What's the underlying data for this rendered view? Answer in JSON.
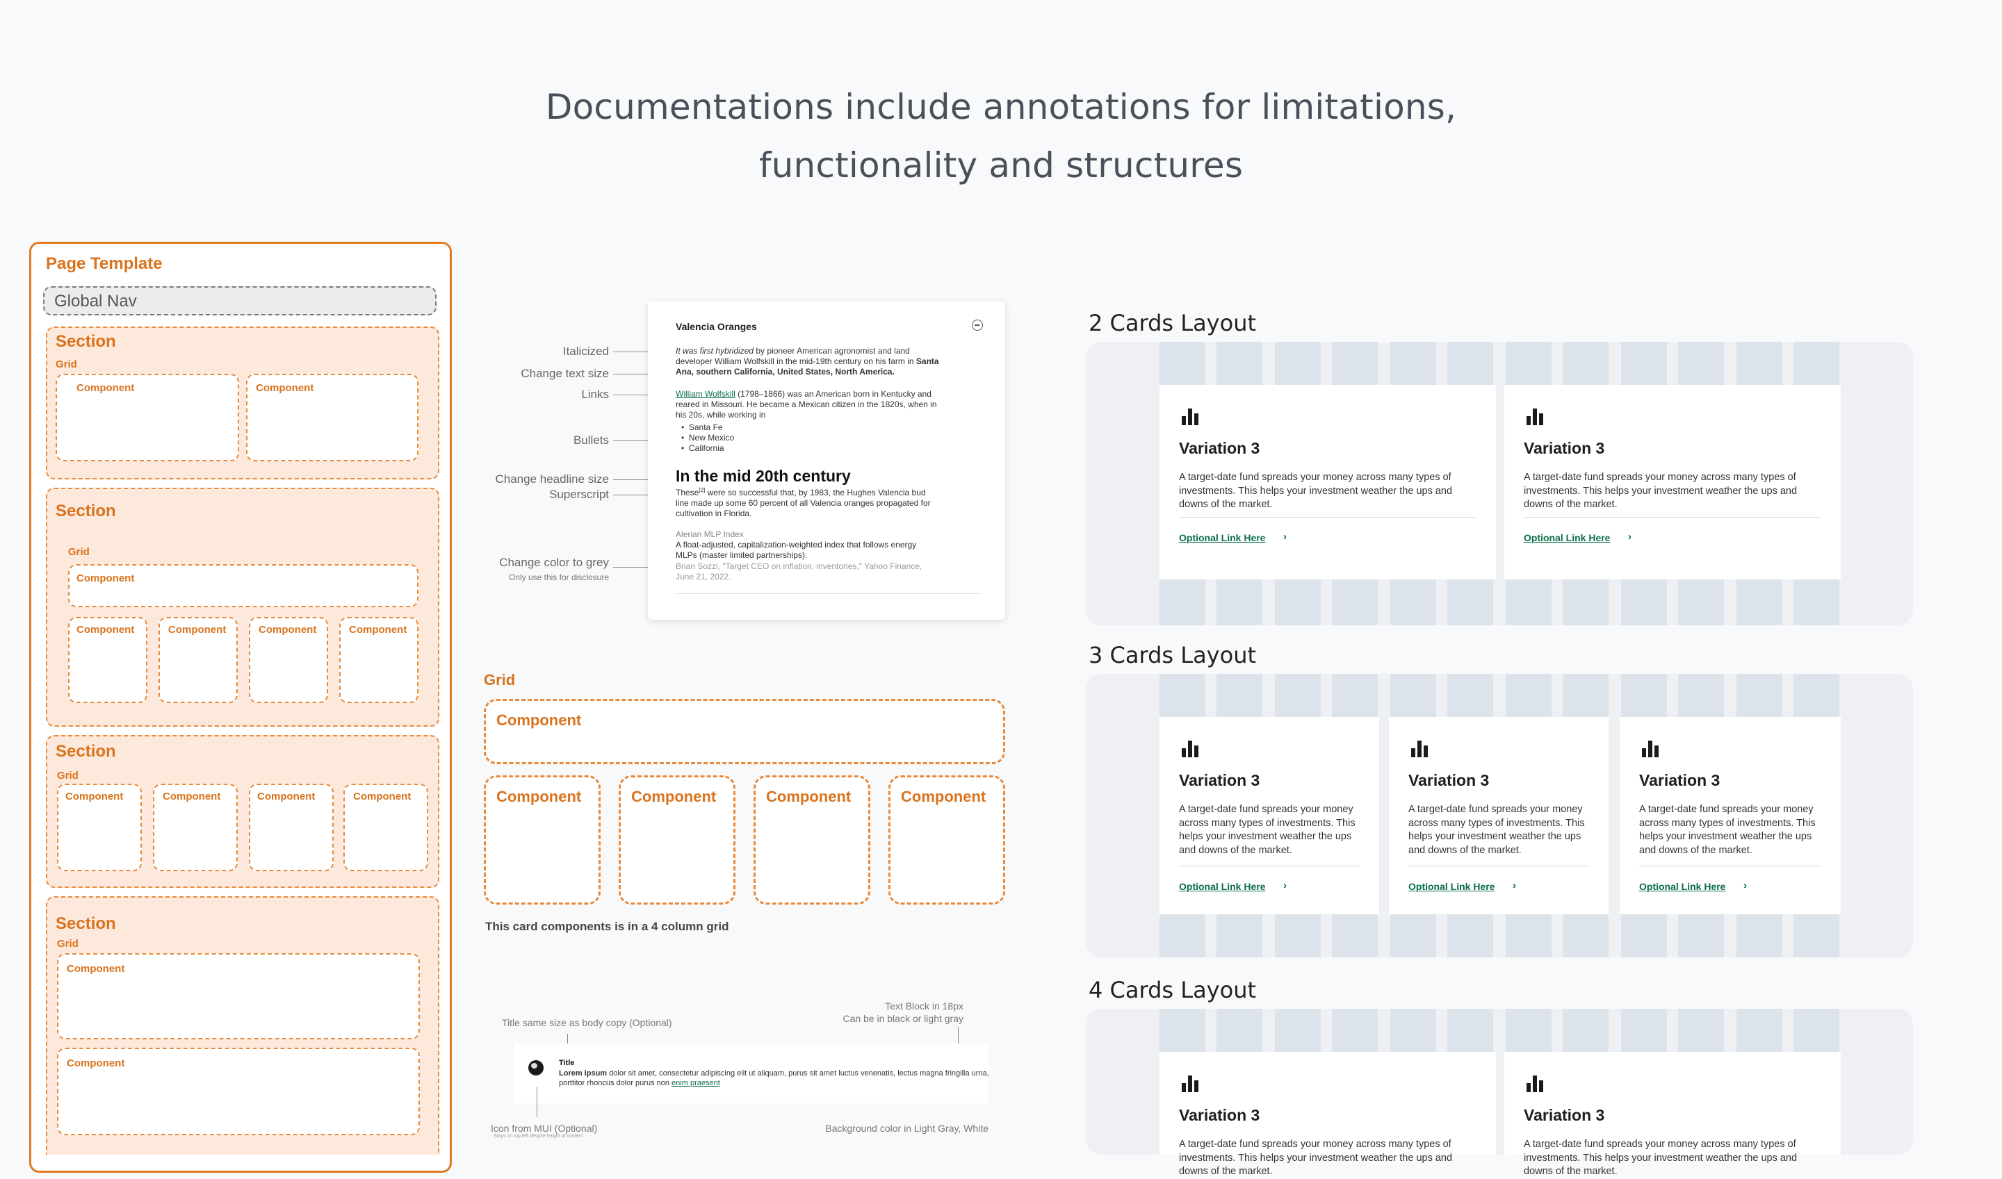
{
  "headline": {
    "line1": "Documentations include annotations for limitations,",
    "line2": "functionality and structures"
  },
  "page_template": {
    "title": "Page Template",
    "global_nav": "Global Nav",
    "section_label": "Section",
    "grid_label": "Grid",
    "component_label": "Component"
  },
  "doc": {
    "title": "Valencia Oranges",
    "close_icon": "close-circle-icon",
    "p1_italic": "It was first hybridized",
    "p1_rest": " by pioneer American agronomist and land developer William Wolfskill in the mid-19th century on his farm in ",
    "p1_bold": "Santa Ana, southern California, United States, North America.",
    "p2_link": "William Wolfskill",
    "p2_rest": " (1798–1866) was an American born in Kentucky and reared in Missouri. He became a Mexican citizen in the 1820s, when in his 20s, while working in",
    "bullets": [
      "Santa Fe",
      "New Mexico",
      "California"
    ],
    "headline": "In the mid 20th century",
    "p3_pre": "These",
    "p3_sup": "[2]",
    "p3_rest": " were so successful that, by 1983, the Hughes Valencia bud line made up some 60 percent of all Valencia oranges propagated for cultivation in Florida.",
    "index_title": "Alerian MLP Index",
    "index_text": "A float-adjusted, capitalization-weighted index that follows energy MLPs (master limited partnerships).",
    "disclosure": "Brian Sozzi, \"Target CEO on inflation, inventories,\" Yahoo Finance, June 21, 2022."
  },
  "annotations": {
    "italicized": "Italicized",
    "change_text_size": "Change text size",
    "links": "Links",
    "bullets": "Bullets",
    "change_headline_size": "Change headline size",
    "superscript": "Superscript",
    "change_color_grey": "Change color to grey",
    "disclosure_note": "Only use this for disclosure"
  },
  "grid_diagram": {
    "title": "Grid",
    "component": "Component",
    "caption": "This card components is in a 4 column grid"
  },
  "text_block": {
    "title_note": "Title same size as body copy (Optional)",
    "text_note_1": "Text Block in 18px",
    "text_note_2": "Can be in black or light gray",
    "icon_note": "Icon from MUI (Optional)",
    "icon_subnote": "Stays on top left despite height of content",
    "bg_note": "Background color in Light Gray, White",
    "icon": "globe-icon",
    "title": "Title",
    "lorem_bold": "Lorem ipsum",
    "lorem_rest": " dolor sit amet, consectetur adipiscing elit ut aliquam, purus sit amet luctus venenatis, lectus magna fringilla urna, porttitor rhoncus dolor purus non ",
    "lorem_link": "enim praesent"
  },
  "layouts": {
    "two": "2 Cards Layout",
    "three": "3 Cards Layout",
    "four": "4 Cards Layout"
  },
  "card": {
    "icon": "bar-chart-icon",
    "title": "Variation 3",
    "body": "A target-date fund spreads your money across many types of investments. This helps your investment weather the ups and downs of the market.",
    "link": "Optional Link Here",
    "chevron": "›"
  }
}
